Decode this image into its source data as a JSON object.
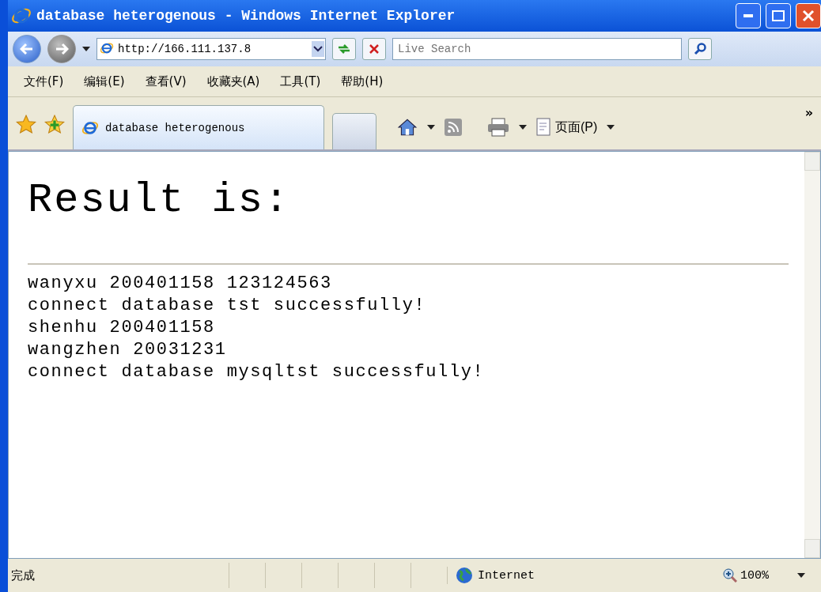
{
  "window": {
    "title": "database heterogenous - Windows Internet Explorer"
  },
  "address_bar": {
    "value": "http://166.111.137.8"
  },
  "search": {
    "placeholder": "Live Search"
  },
  "menu": [
    "文件(F)",
    "编辑(E)",
    "查看(V)",
    "收藏夹(A)",
    "工具(T)",
    "帮助(H)"
  ],
  "tabs": [
    {
      "label": "database heterogenous",
      "selected": true
    }
  ],
  "command_bar": {
    "page_label": "页面(P)",
    "overflow": "»"
  },
  "content": {
    "heading": "Result is:",
    "lines": [
      "wanyxu 200401158 123124563",
      "connect database tst successfully!",
      "shenhu 200401158",
      "wangzhen 20031231",
      "connect database mysqltst successfully!"
    ]
  },
  "status_bar": {
    "status": "完成",
    "zone": "Internet",
    "zoom": "100%"
  }
}
